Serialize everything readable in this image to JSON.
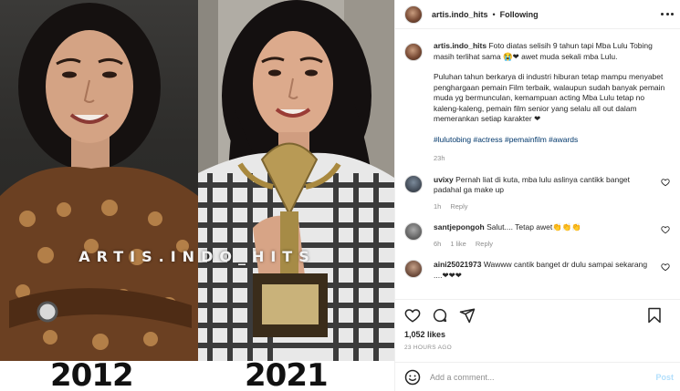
{
  "photo": {
    "watermark": "ARTIS.INDO_HITS",
    "year_left": "2012",
    "year_right": "2021"
  },
  "header": {
    "username": "artis.indo_hits",
    "separator": "•",
    "follow_status": "Following",
    "more_icon": "more-horizontal-icon"
  },
  "caption": {
    "username": "artis.indo_hits",
    "paragraph1": "Foto diatas selisih 9 tahun tapi Mba Lulu Tobing masih terlihat sama 😭❤ awet muda sekali mba Lulu.",
    "paragraph2": "Puluhan tahun berkarya di industri hiburan tetap mampu menyabet penghargaan pemain Film terbaik, walaupun sudah banyak pemain muda yg bermunculan, kemampuan acting Mba Lulu tetap no kaleng-kaleng, pemain film senior yang selalu all out dalam memerankan setiap karakter ❤",
    "hashtags": "#lulutobing #actress #pemainfilm #awards",
    "time": "23h"
  },
  "comments": [
    {
      "username": "uvixy",
      "text": "Pernah liat di kuta, mba lulu aslinya cantikk banget padahal ga make up",
      "time": "1h",
      "likes": "",
      "reply": "Reply"
    },
    {
      "username": "santjepongoh",
      "text": "Salut.... Tetap awet👏👏👏",
      "time": "6h",
      "likes": "1 like",
      "reply": "Reply"
    },
    {
      "username": "aini25021973",
      "text": "Wawww cantik banget dr dulu sampai sekarang ....❤❤❤",
      "time": "",
      "likes": "",
      "reply": ""
    }
  ],
  "stats": {
    "likes": "1,052 likes",
    "posted": "23 HOURS AGO"
  },
  "add_comment": {
    "placeholder": "Add a comment...",
    "post_label": "Post"
  },
  "colors": {
    "link": "#00376b",
    "muted": "#8e8e8e",
    "post_disabled": "#b2dffc",
    "heart_red": "#ed4956"
  }
}
